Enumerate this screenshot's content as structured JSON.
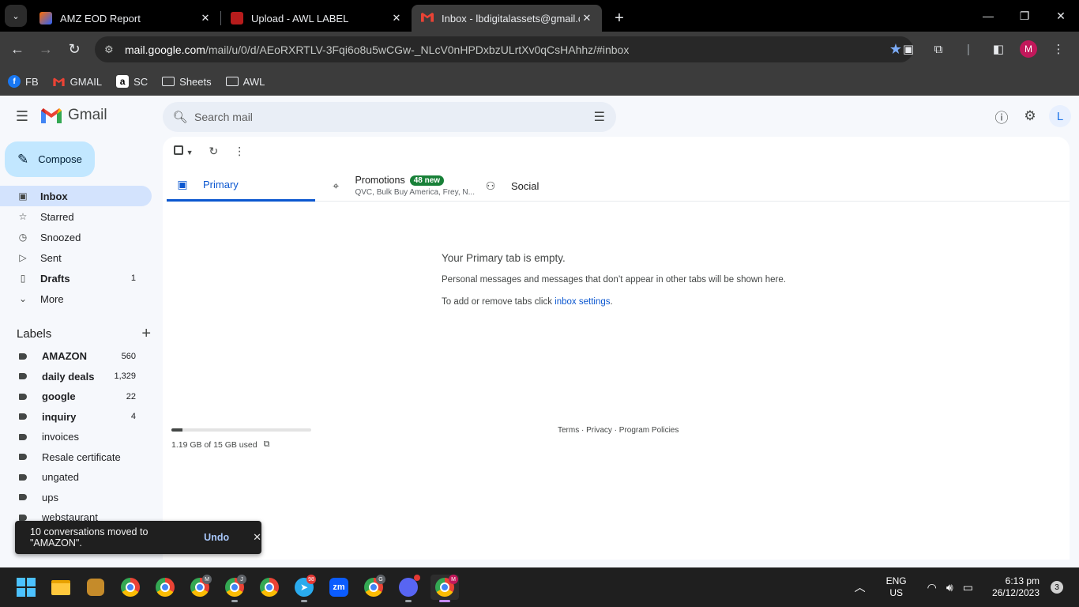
{
  "browser": {
    "tabs": [
      {
        "title": "AMZ EOD Report",
        "favicon_color": "#ff6d00",
        "active": false
      },
      {
        "title": "Upload - AWL LABEL",
        "favicon_color": "#b71c1c",
        "active": false
      },
      {
        "title": "Inbox - lbdigitalassets@gmail.com",
        "favicon_color": "#ea4335",
        "active": true
      }
    ],
    "url_host": "mail.google.com",
    "url_path": "/mail/u/0/d/AEoRXRTLV-3Fqi6o8u5wCGw-_NLcV0nHPDxbzULrtXv0qCsHAhhz/#inbox",
    "profile_initial": "M",
    "bookmarks": [
      {
        "label": "FB",
        "icon": "facebook-icon",
        "color": "#1877f2"
      },
      {
        "label": "GMAIL",
        "icon": "gmail-icon",
        "color": "#ea4335"
      },
      {
        "label": "SC",
        "icon": "amazon-icon",
        "color": "#000000"
      },
      {
        "label": "Sheets",
        "icon": "folder-icon",
        "color": "#e8eaed"
      },
      {
        "label": "AWL",
        "icon": "folder-icon",
        "color": "#e8eaed"
      }
    ]
  },
  "gmail": {
    "brand": "Gmail",
    "search_placeholder": "Search mail",
    "account_initial": "L",
    "compose_label": "Compose",
    "nav": [
      {
        "label": "Inbox",
        "icon": "inbox-icon",
        "count": "",
        "active": true
      },
      {
        "label": "Starred",
        "icon": "star-icon",
        "count": ""
      },
      {
        "label": "Snoozed",
        "icon": "clock-icon",
        "count": ""
      },
      {
        "label": "Sent",
        "icon": "send-icon",
        "count": ""
      },
      {
        "label": "Drafts",
        "icon": "draft-icon",
        "count": "1",
        "bold": true
      },
      {
        "label": "More",
        "icon": "chevron-down-icon",
        "count": ""
      }
    ],
    "labels_title": "Labels",
    "labels": [
      {
        "label": "AMAZON",
        "count": "560",
        "bold": true
      },
      {
        "label": "daily deals",
        "count": "1,329",
        "bold": true
      },
      {
        "label": "google",
        "count": "22",
        "bold": true
      },
      {
        "label": "inquiry",
        "count": "4",
        "bold": true
      },
      {
        "label": "invoices",
        "count": ""
      },
      {
        "label": "Resale certificate",
        "count": ""
      },
      {
        "label": "ungated",
        "count": ""
      },
      {
        "label": "ups",
        "count": ""
      },
      {
        "label": "webstaurant",
        "count": ""
      }
    ],
    "tabs": {
      "primary": "Primary",
      "promotions": "Promotions",
      "promotions_badge": "48 new",
      "promotions_senders": "QVC, Bulk Buy America, Frey, N...",
      "social": "Social"
    },
    "empty": {
      "title": "Your Primary tab is empty.",
      "line1": "Personal messages and messages that don’t appear in other tabs will be shown here.",
      "line2_prefix": "To add or remove tabs click ",
      "line2_link": "inbox settings",
      "line2_suffix": "."
    },
    "storage": {
      "text": "1.19 GB of 15 GB used",
      "fraction": 0.079
    },
    "footer": "Terms · Privacy · Program Policies",
    "snackbar": {
      "message": "10 conversations moved to \"AMAZON\".",
      "action": "Undo"
    }
  },
  "taskbar": {
    "apps": [
      {
        "name": "start-button"
      },
      {
        "name": "file-explorer-icon"
      },
      {
        "name": "app-icon-1"
      },
      {
        "name": "chrome-profile-1",
        "badge": ""
      },
      {
        "name": "chrome-profile-2",
        "badge": ""
      },
      {
        "name": "chrome-profile-3",
        "badge": "M"
      },
      {
        "name": "chrome-profile-4",
        "badge": "J"
      },
      {
        "name": "chrome-profile-5",
        "badge": ""
      },
      {
        "name": "telegram-icon",
        "badge": "98"
      },
      {
        "name": "zoom-icon",
        "badge": ""
      },
      {
        "name": "chrome-profile-6",
        "badge": "G"
      },
      {
        "name": "discord-icon",
        "badge": ""
      },
      {
        "name": "chrome-profile-7",
        "badge": "M"
      }
    ],
    "lang_top": "ENG",
    "lang_bottom": "US",
    "time": "6:13 pm",
    "date": "26/12/2023",
    "notifications": "3"
  }
}
